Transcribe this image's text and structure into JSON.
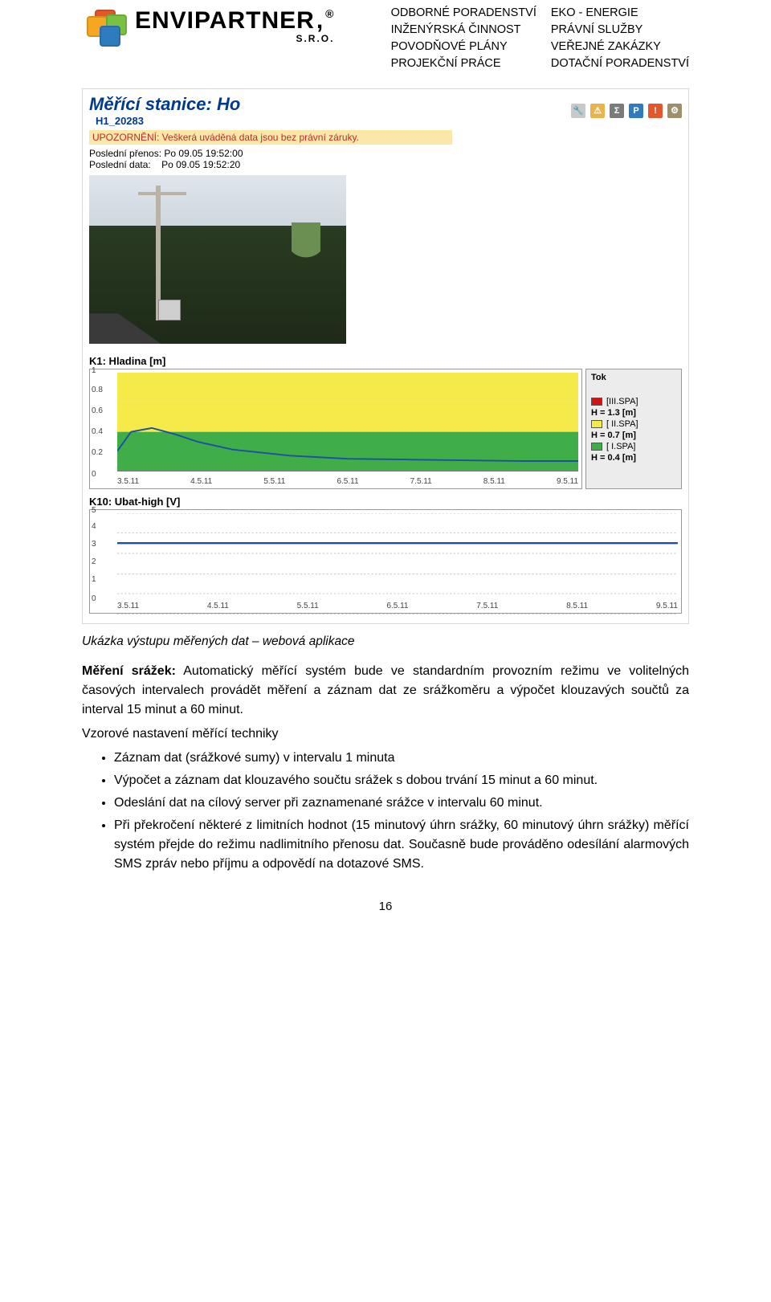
{
  "header": {
    "brand_name": "ENVIPARTNER",
    "brand_suffix_comma": ",",
    "brand_reg": "®",
    "brand_sro": "S.R.O.",
    "services_left": [
      "ODBORNÉ PORADENSTVÍ",
      "INŽENÝRSKÁ ČINNOST",
      "POVODŇOVÉ PLÁNY",
      "PROJEKČNÍ PRÁCE"
    ],
    "services_right": [
      "EKO - ENERGIE",
      "PRÁVNÍ SLUŽBY",
      "VEŘEJNÉ ZAKÁZKY",
      "DOTAČNÍ PORADENSTVÍ"
    ]
  },
  "app": {
    "title": "Měřící stanice: Ho",
    "subtitle": "H1_20283",
    "warning": "UPOZORNĚNÍ: Veškerá uváděná data jsou bez právní záruky.",
    "meta1_label": "Poslední přenos:",
    "meta1_value": "Po 09.05 19:52:00",
    "meta2_label": "Poslední data:",
    "meta2_value": "Po 09.05 19:52:20",
    "icons": [
      "wrench",
      "warn",
      "Σ",
      "P",
      "!",
      "gear"
    ],
    "chart1_title": "K1: Hladina [m]",
    "chart2_title": "K10: Ubat-high [V]",
    "legend1": {
      "tok": "Tok",
      "items": [
        {
          "name": "[III.SPA]",
          "value": "H = 1.3 [m]",
          "color": "#d11313"
        },
        {
          "name": "[ II.SPA]",
          "value": "H = 0.7 [m]",
          "color": "#f6e94a"
        },
        {
          "name": "[ I.SPA]",
          "value": "H = 0.4 [m]",
          "color": "#3fae49"
        }
      ]
    }
  },
  "chart_data": [
    {
      "type": "line",
      "title": "K1: Hladina [m]",
      "xlabel": "",
      "ylabel": "Hladina [m]",
      "ylim": [
        0.0,
        1.0
      ],
      "y_ticks": [
        0.0,
        0.2,
        0.4,
        0.6,
        0.8,
        1.0
      ],
      "x_ticks": [
        "3.5.11",
        "4.5.11",
        "5.5.11",
        "6.5.11",
        "7.5.11",
        "8.5.11",
        "9.5.11"
      ],
      "zones": [
        {
          "name": "I.SPA",
          "y0": 0.0,
          "y1": 0.4,
          "color": "#3fae49"
        },
        {
          "name": "II.SPA",
          "y0": 0.4,
          "y1": 0.7,
          "color": "#f6e94a"
        },
        {
          "name": "III.SPA",
          "y0": 0.7,
          "y1": 1.0,
          "color": "#f6e94a"
        }
      ],
      "x": [
        "3.5.11",
        "3.6.11",
        "3.8.11",
        "4.0.11",
        "4.2.11",
        "4.5.11",
        "5.0.11",
        "5.5.11",
        "6.0.11",
        "6.5.11",
        "7.0.11",
        "7.5.11",
        "8.0.11",
        "8.5.11",
        "9.0.11",
        "9.5.11"
      ],
      "values": [
        0.2,
        0.4,
        0.38,
        0.3,
        0.24,
        0.18,
        0.14,
        0.12,
        0.11,
        0.11,
        0.1,
        0.1,
        0.1,
        0.1,
        0.1,
        0.1
      ]
    },
    {
      "type": "line",
      "title": "K10: Ubat-high [V]",
      "xlabel": "",
      "ylabel": "Ubat-high [V]",
      "ylim": [
        0.0,
        5.0
      ],
      "y_ticks": [
        0.0,
        1.0,
        2.0,
        3.0,
        4.0,
        5.0
      ],
      "x_ticks": [
        "3.5.11",
        "4.5.11",
        "5.5.11",
        "6.5.11",
        "7.5.11",
        "8.5.11",
        "9.5.11"
      ],
      "x": [
        "3.5.11",
        "4.5.11",
        "5.5.11",
        "6.5.11",
        "7.5.11",
        "8.5.11",
        "9.5.11"
      ],
      "values": [
        3.5,
        3.5,
        3.5,
        3.5,
        3.5,
        3.5,
        3.5
      ]
    }
  ],
  "doc": {
    "caption": "Ukázka výstupu měřených dat – webová aplikace",
    "p1_lead": "Měření srážek:",
    "p1_rest": " Automatický měřící systém bude ve standardním provozním režimu ve volitelných časových intervalech provádět měření a záznam dat ze srážkoměru a výpočet klouzavých součtů za interval 15 minut a 60 minut.",
    "p2": "Vzorové nastavení měřící techniky",
    "bul1": "Záznam dat (srážkové sumy) v intervalu 1 minuta",
    "bul2": "Výpočet a záznam dat klouzavého součtu srážek s dobou trvání 15 minut a 60 minut.",
    "bul3": "Odeslání dat na cílový server při zaznamenané srážce v intervalu 60 minut.",
    "bul4": "Při překročení některé z limitních hodnot (15 minutový úhrn srážky, 60 minutový úhrn srážky) měřící systém přejde do režimu nadlimitního přenosu dat. Současně bude prováděno odesílání alarmových SMS zpráv nebo příjmu a odpovědí na dotazové SMS.",
    "page_number": "16"
  }
}
